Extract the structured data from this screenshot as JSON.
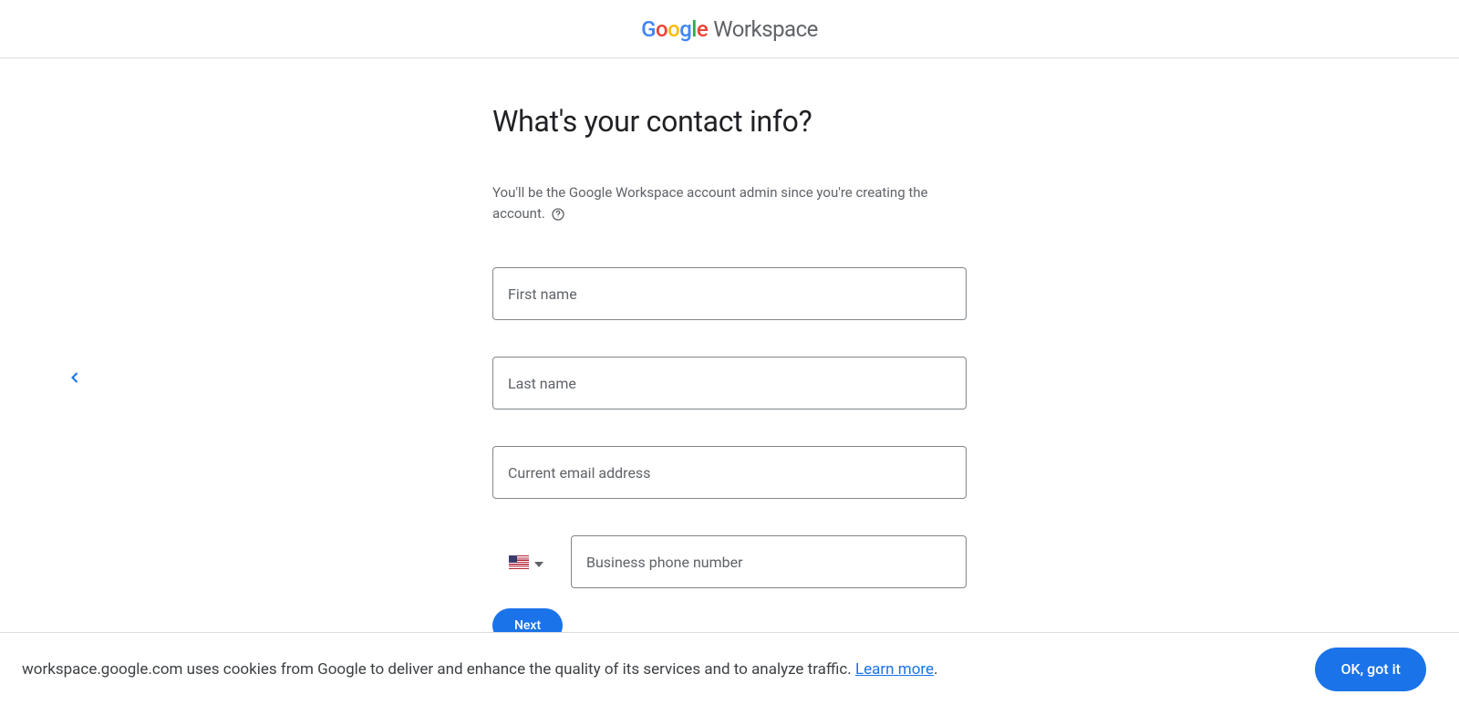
{
  "header": {
    "logo_brand": "Google",
    "logo_product": "Workspace"
  },
  "form": {
    "title": "What's your contact info?",
    "description": "You'll be the Google Workspace account admin since you're creating the account.",
    "first_name_placeholder": "First name",
    "last_name_placeholder": "Last name",
    "email_placeholder": "Current email address",
    "phone_placeholder": "Business phone number",
    "next_button": "Next",
    "country_code": "US"
  },
  "cookie": {
    "text": "workspace.google.com uses cookies from Google to deliver and enhance the quality of its services and to analyze traffic. ",
    "link": "Learn more",
    "period": ".",
    "accept": "OK, got it"
  }
}
